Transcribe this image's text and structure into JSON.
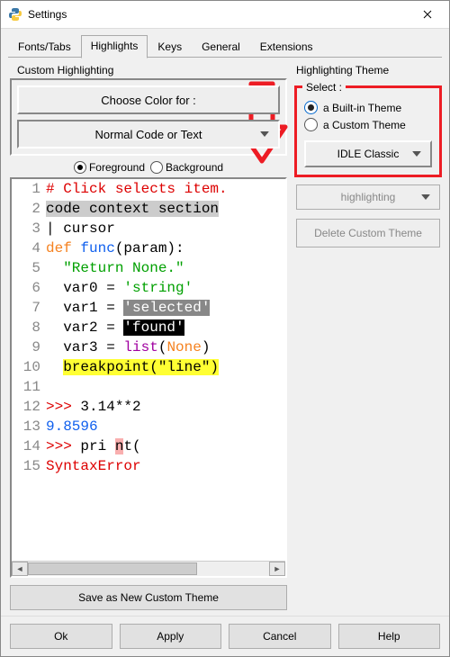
{
  "window": {
    "title": "Settings"
  },
  "tabs": {
    "items": [
      "Fonts/Tabs",
      "Highlights",
      "Keys",
      "General",
      "Extensions"
    ],
    "active": 1
  },
  "left": {
    "group_label": "Custom Highlighting",
    "choose_btn": "Choose Color for :",
    "element_btn": "Normal Code or Text",
    "fg_label": "Foreground",
    "bg_label": "Background",
    "fg_selected": true,
    "save_btn": "Save as New Custom Theme"
  },
  "code": {
    "lines": [
      {
        "n": 1,
        "segs": [
          {
            "t": "# Click selects item.",
            "cls": "c-cm"
          }
        ]
      },
      {
        "n": 2,
        "segs": [
          {
            "t": "code context section",
            "cls": "c-bg-gray"
          }
        ]
      },
      {
        "n": 3,
        "segs": [
          {
            "t": "| cursor",
            "cls": ""
          }
        ]
      },
      {
        "n": 4,
        "segs": [
          {
            "t": "def ",
            "cls": "c-kw"
          },
          {
            "t": "func",
            "cls": "c-def"
          },
          {
            "t": "(param):",
            "cls": ""
          }
        ]
      },
      {
        "n": 5,
        "segs": [
          {
            "t": "  ",
            "cls": ""
          },
          {
            "t": "\"Return None.\"",
            "cls": "c-str"
          }
        ]
      },
      {
        "n": 6,
        "segs": [
          {
            "t": "  var0 = ",
            "cls": ""
          },
          {
            "t": "'string'",
            "cls": "c-str"
          }
        ]
      },
      {
        "n": 7,
        "segs": [
          {
            "t": "  var1 = ",
            "cls": ""
          },
          {
            "t": "'selected'",
            "cls": "c-sel"
          }
        ]
      },
      {
        "n": 8,
        "segs": [
          {
            "t": "  var2 = ",
            "cls": ""
          },
          {
            "t": "'found'",
            "cls": "c-found"
          }
        ]
      },
      {
        "n": 9,
        "segs": [
          {
            "t": "  var3 = ",
            "cls": ""
          },
          {
            "t": "list",
            "cls": "c-bi"
          },
          {
            "t": "(",
            "cls": ""
          },
          {
            "t": "None",
            "cls": "c-kw"
          },
          {
            "t": ")",
            "cls": ""
          }
        ]
      },
      {
        "n": 10,
        "segs": [
          {
            "t": "  ",
            "cls": ""
          },
          {
            "t": "breakpoint(\"line\")",
            "cls": "c-bpline"
          }
        ]
      },
      {
        "n": 11,
        "segs": [
          {
            "t": "",
            "cls": ""
          }
        ]
      },
      {
        "n": 12,
        "segs": [
          {
            "t": ">>>",
            "cls": "c-err"
          },
          {
            "t": " 3.14**2",
            "cls": ""
          }
        ]
      },
      {
        "n": 13,
        "segs": [
          {
            "t": "9.8596",
            "cls": "c-num"
          }
        ]
      },
      {
        "n": 14,
        "segs": [
          {
            "t": ">>>",
            "cls": "c-err"
          },
          {
            "t": " pri ",
            "cls": ""
          },
          {
            "t": "n",
            "cls": "c-cursorbox"
          },
          {
            "t": "t(",
            "cls": ""
          }
        ]
      },
      {
        "n": 15,
        "segs": [
          {
            "t": "SyntaxError",
            "cls": "c-err"
          }
        ]
      }
    ]
  },
  "right": {
    "group_label": "Highlighting Theme",
    "select_label": "Select :",
    "builtin_label": "a Built-in Theme",
    "custom_label": "a Custom Theme",
    "builtin_selected": true,
    "theme_btn": "IDLE Classic",
    "highlighting_btn": "highlighting",
    "delete_btn": "Delete Custom Theme"
  },
  "bottom": {
    "ok": "Ok",
    "apply": "Apply",
    "cancel": "Cancel",
    "help": "Help"
  }
}
